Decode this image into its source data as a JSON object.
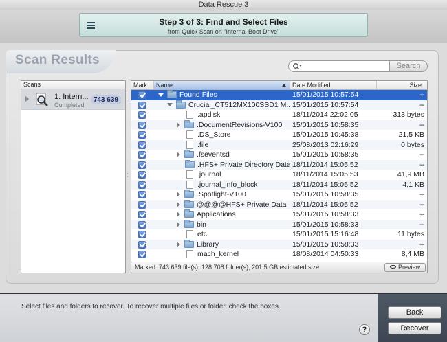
{
  "window": {
    "title": "Data Rescue 3"
  },
  "step": {
    "title": "Step 3 of 3: Find and Select Files",
    "subtitle": "from Quick Scan on \"Internal Boot Drive\""
  },
  "section_title": "Scan Results",
  "search": {
    "placeholder": "",
    "button_label": "Search"
  },
  "scans": {
    "header": "Scans",
    "items": [
      {
        "name": "1. Intern...",
        "status": "Completed",
        "count": "743 639"
      }
    ]
  },
  "files": {
    "columns": {
      "mark": "Mark",
      "name": "Name",
      "date": "Date Modified",
      "size": "Size"
    },
    "rows": [
      {
        "name": "Found Files",
        "date": "15/01/2015 10:57:54",
        "size": "--",
        "level": 0,
        "disclosure": "open",
        "icon": "folder-icon",
        "selected": true
      },
      {
        "name": "Crucial_CT512MX100SSD1 M...",
        "date": "15/01/2015 10:57:54",
        "size": "--",
        "level": 1,
        "disclosure": "open",
        "icon": "folder-icon",
        "selected": false
      },
      {
        "name": ".apdisk",
        "date": "18/11/2014 22:02:05",
        "size": "313 bytes",
        "level": 2,
        "disclosure": "none",
        "icon": "file-icon",
        "selected": false
      },
      {
        "name": ".DocumentRevisions-V100",
        "date": "15/01/2015 10:58:35",
        "size": "--",
        "level": 2,
        "disclosure": "closed",
        "icon": "folder-icon",
        "selected": false
      },
      {
        "name": ".DS_Store",
        "date": "15/01/2015 10:45:38",
        "size": "21,5 KB",
        "level": 2,
        "disclosure": "none",
        "icon": "file-icon",
        "selected": false
      },
      {
        "name": ".file",
        "date": "25/08/2013 02:16:29",
        "size": "0 bytes",
        "level": 2,
        "disclosure": "none",
        "icon": "file-icon",
        "selected": false
      },
      {
        "name": ".fseventsd",
        "date": "15/01/2015 10:58:35",
        "size": "--",
        "level": 2,
        "disclosure": "closed",
        "icon": "folder-icon",
        "selected": false
      },
      {
        "name": ".HFS+ Private Directory Data",
        "date": "18/11/2014 15:05:52",
        "size": "--",
        "level": 2,
        "disclosure": "none",
        "icon": "folder-icon",
        "selected": false
      },
      {
        "name": ".journal",
        "date": "18/11/2014 15:05:53",
        "size": "41,9 MB",
        "level": 2,
        "disclosure": "none",
        "icon": "file-icon",
        "selected": false
      },
      {
        "name": ".journal_info_block",
        "date": "18/11/2014 15:05:52",
        "size": "4,1 KB",
        "level": 2,
        "disclosure": "none",
        "icon": "file-icon",
        "selected": false
      },
      {
        "name": ".Spotlight-V100",
        "date": "15/01/2015 10:58:35",
        "size": "--",
        "level": 2,
        "disclosure": "closed",
        "icon": "folder-icon",
        "selected": false
      },
      {
        "name": "@@@@HFS+ Private Data",
        "date": "18/11/2014 15:05:52",
        "size": "--",
        "level": 2,
        "disclosure": "closed",
        "icon": "folder-icon",
        "selected": false
      },
      {
        "name": "Applications",
        "date": "15/01/2015 10:58:33",
        "size": "--",
        "level": 2,
        "disclosure": "closed",
        "icon": "folder-icon",
        "selected": false
      },
      {
        "name": "bin",
        "date": "15/01/2015 10:58:33",
        "size": "--",
        "level": 2,
        "disclosure": "closed",
        "icon": "folder-icon",
        "selected": false
      },
      {
        "name": "etc",
        "date": "15/01/2015 15:16:48",
        "size": "11 bytes",
        "level": 2,
        "disclosure": "none",
        "icon": "file-icon",
        "selected": false
      },
      {
        "name": "Library",
        "date": "15/01/2015 10:58:33",
        "size": "--",
        "level": 2,
        "disclosure": "closed",
        "icon": "folder-icon",
        "selected": false
      },
      {
        "name": "mach_kernel",
        "date": "18/08/2014 04:50:33",
        "size": "8,4 MB",
        "level": 2,
        "disclosure": "none",
        "icon": "file-icon",
        "selected": false
      }
    ],
    "status": "Marked: 743 639 file(s), 128 708 folder(s), 201,5 GB estimated size",
    "preview_label": "Preview"
  },
  "footer": {
    "message": "Select files and folders to recover. To recover multiple files or folder, check the boxes.",
    "help_label": "?",
    "back_label": "Back",
    "recover_label": "Recover"
  },
  "colors": {
    "selection": "#2c66c8",
    "footer": "#4f5966",
    "banner": "#c6dedb"
  }
}
